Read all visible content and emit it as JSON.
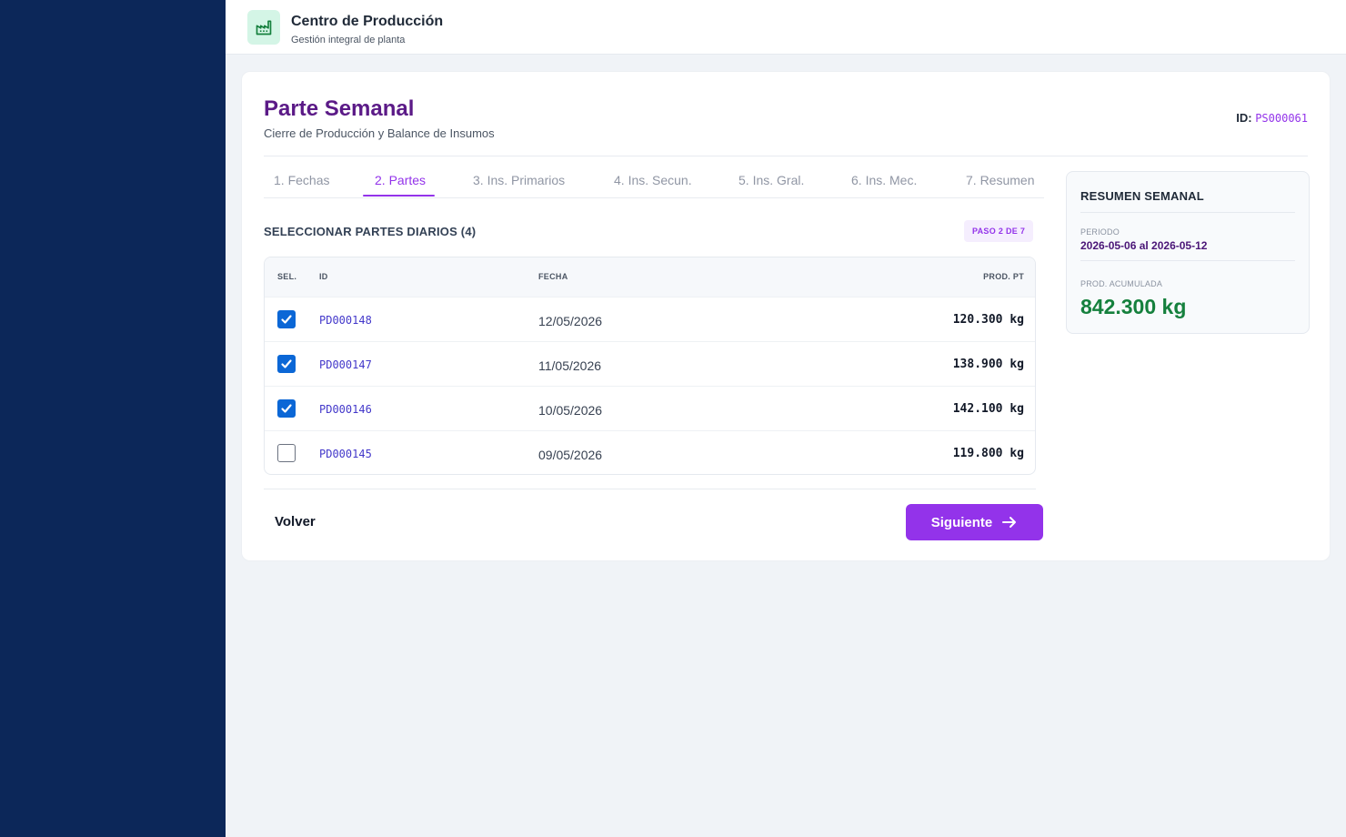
{
  "header": {
    "app_title": "Centro de Producción",
    "app_subtitle": "Gestión integral de planta",
    "logo_icon": "factory-icon"
  },
  "page": {
    "title": "Parte Semanal",
    "subtitle": "Cierre de Producción y Balance de Insumos",
    "id_label": "ID:",
    "id_value": "PS000061"
  },
  "tabs": [
    {
      "label": "1. Fechas",
      "active": false
    },
    {
      "label": "2. Partes",
      "active": true
    },
    {
      "label": "3. Ins. Primarios",
      "active": false
    },
    {
      "label": "4. Ins. Secun.",
      "active": false
    },
    {
      "label": "5. Ins. Gral.",
      "active": false
    },
    {
      "label": "6. Ins. Mec.",
      "active": false
    },
    {
      "label": "7. Resumen",
      "active": false
    }
  ],
  "section": {
    "title": "SELECCIONAR PARTES DIARIOS (4)",
    "step_badge": "PASO 2 DE 7"
  },
  "table": {
    "headers": {
      "sel": "SEL.",
      "id": "ID",
      "fecha": "FECHA",
      "prod": "PROD. PT"
    },
    "rows": [
      {
        "selected": true,
        "id": "PD000148",
        "fecha": "12/05/2026",
        "prod": "120.300 kg"
      },
      {
        "selected": true,
        "id": "PD000147",
        "fecha": "11/05/2026",
        "prod": "138.900 kg"
      },
      {
        "selected": true,
        "id": "PD000146",
        "fecha": "10/05/2026",
        "prod": "142.100 kg"
      },
      {
        "selected": false,
        "id": "PD000145",
        "fecha": "09/05/2026",
        "prod": "119.800 kg"
      }
    ]
  },
  "actions": {
    "back_label": "Volver",
    "next_label": "Siguiente",
    "next_icon": "arrow-right-icon"
  },
  "summary": {
    "title": "RESUMEN SEMANAL",
    "period_label": "PERIODO",
    "period_value": "2026-05-06 al 2026-05-12",
    "total_label": "PROD. ACUMULADA",
    "total_value": "842.300 kg"
  },
  "colors": {
    "sidebar": "#0c2759",
    "accent": "#9333ea",
    "title": "#5b1a87",
    "checkbox": "#0b67d6",
    "total": "#15803d"
  }
}
